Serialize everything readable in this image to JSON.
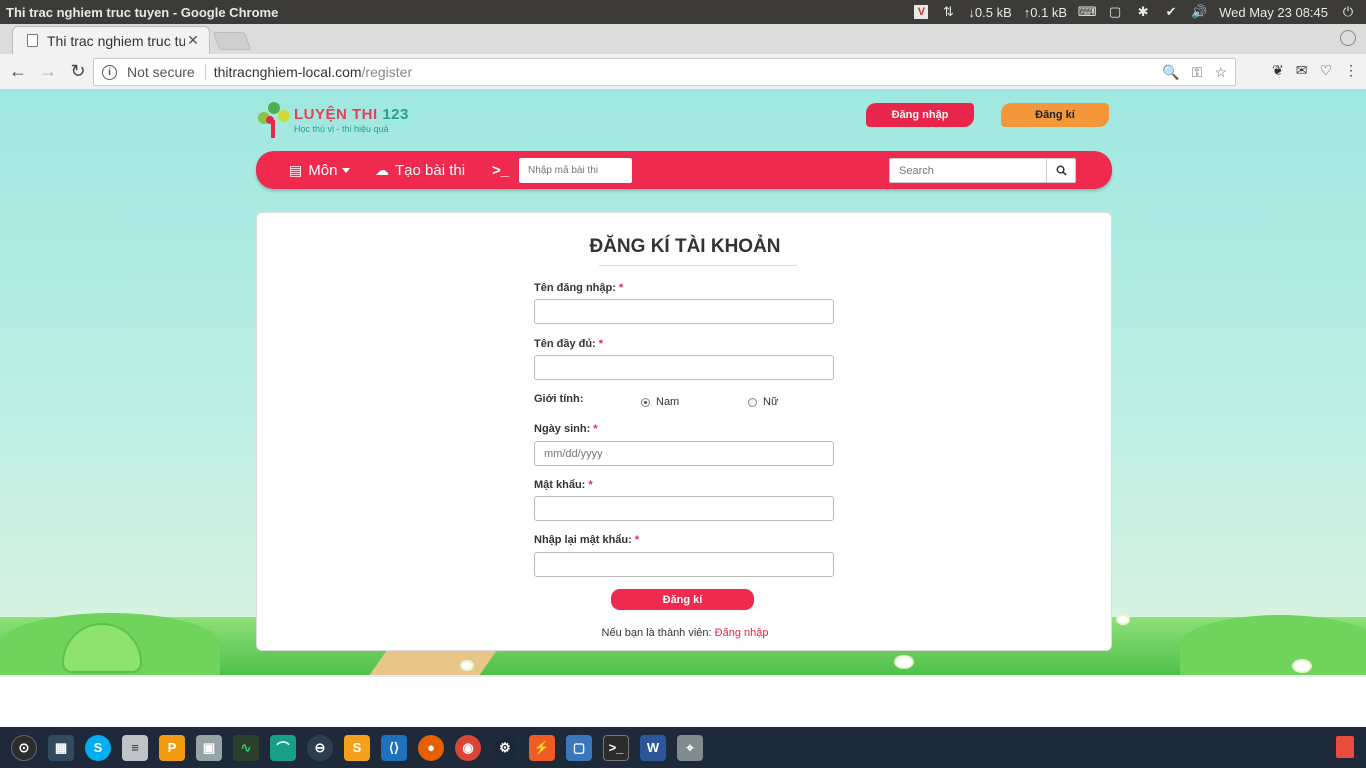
{
  "os": {
    "window_title": "Thi trac nghiem truc tuyen - Google Chrome",
    "net_down": "↓0.5 kB",
    "net_up": "↑0.1 kB",
    "clock": "Wed May 23 08:45"
  },
  "browser": {
    "tab_title": "Thi trac nghiem truc tuyen",
    "not_secure": "Not secure",
    "url_host": "thitracnghiem-local.com",
    "url_path": "/register"
  },
  "site": {
    "logo_main": "LUYỆN THI ",
    "logo_num": "123",
    "logo_sub": "Học thú vị - thi hiệu quả",
    "login_btn": "Đăng nhập",
    "register_btn": "Đăng kí",
    "nav": {
      "subjects": "Môn",
      "create_exam": "Tạo bài thi",
      "exam_code_placeholder": "Nhập mã bài thi",
      "search_placeholder": "Search"
    }
  },
  "form": {
    "title": "ĐĂNG KÍ TÀI KHOẢN",
    "username_label": "Tên đăng nhập:",
    "fullname_label": "Tên đầy đủ:",
    "gender_label": "Giới tính:",
    "gender_male": "Nam",
    "gender_female": "Nữ",
    "birthday_label": "Ngày sinh:",
    "birthday_placeholder": "mm/dd/yyyy",
    "password_label": "Mật khẩu:",
    "confirm_label": "Nhập lại mật khẩu:",
    "required_mark": "*",
    "submit": "Đăng kí",
    "member_note": "Nếu bạn là thành viên: ",
    "member_link": "Đăng nhập"
  },
  "colors": {
    "brand_red": "#f0294e",
    "brand_orange": "#f4973a",
    "sky": "#9fe8e0"
  }
}
